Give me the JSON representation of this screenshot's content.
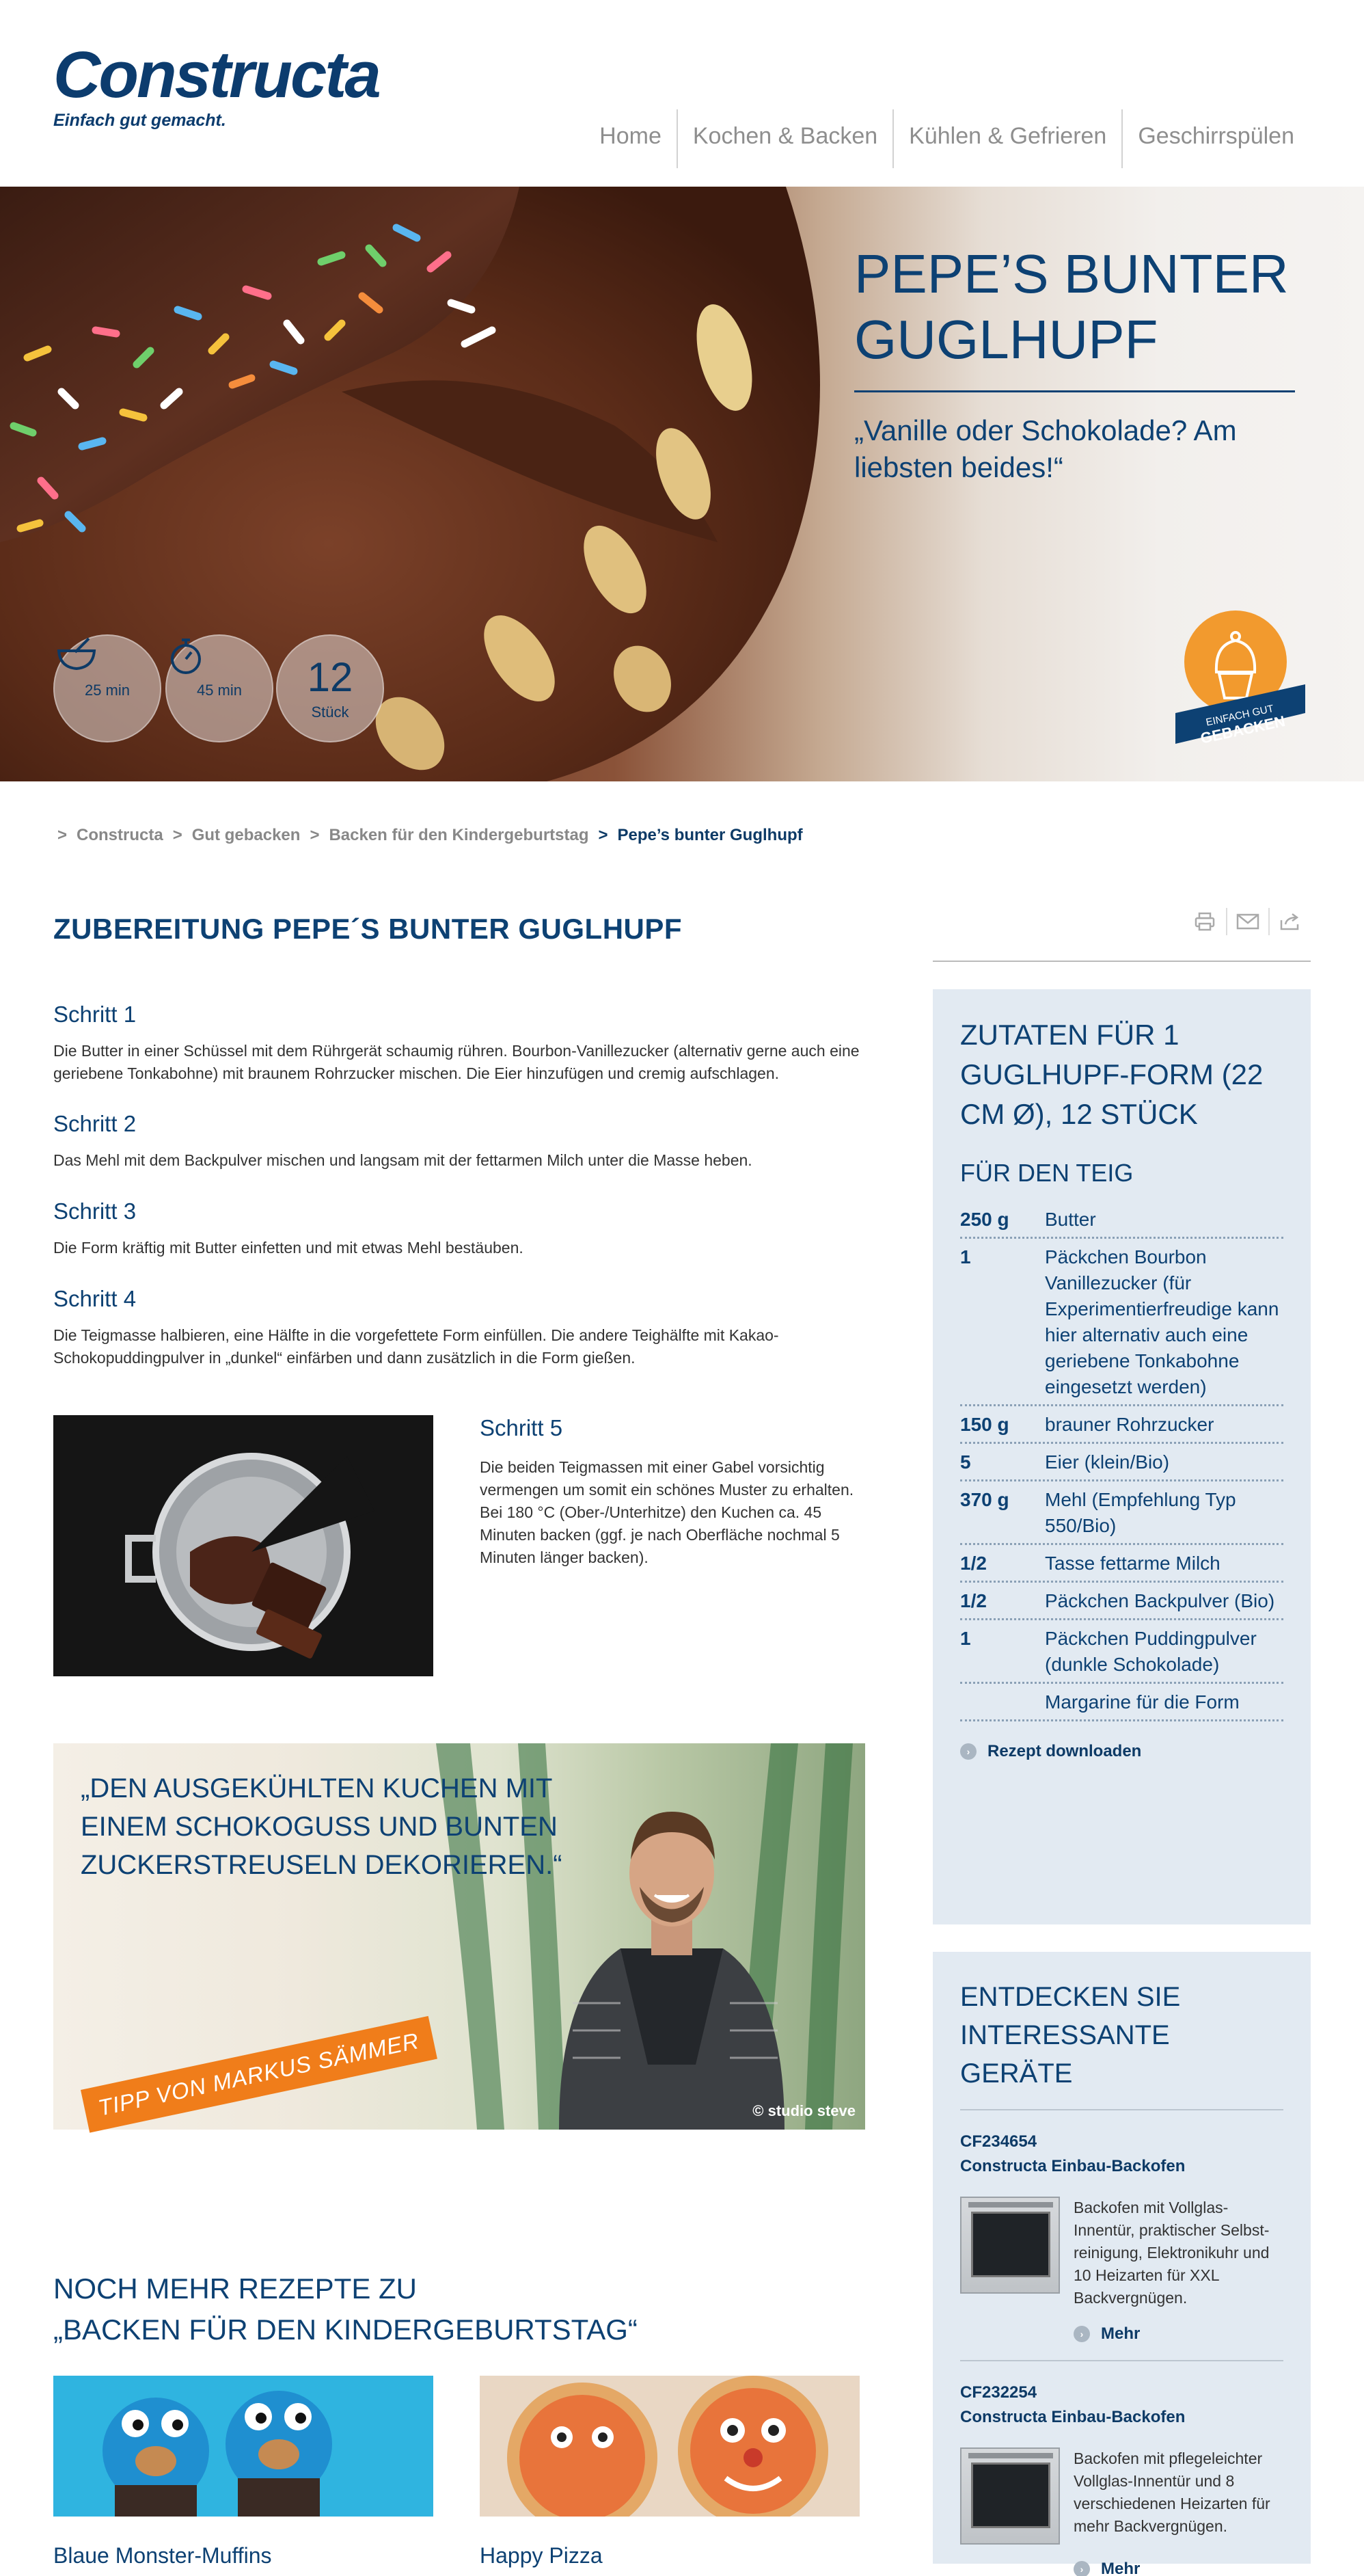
{
  "brand": {
    "name": "Constructa",
    "tagline": "Einfach gut gemacht."
  },
  "nav": {
    "items": [
      "Home",
      "Kochen & Backen",
      "Kühlen & Gefrieren",
      "Geschirrspülen"
    ]
  },
  "hero": {
    "title": "PEPE’S BUNTER GUGLHUPF",
    "quote": "„Vanille oder Schokolade? Am liebsten beides!“",
    "stats": [
      {
        "icon": "mixing-bowl-icon",
        "value": "",
        "label": "25 min"
      },
      {
        "icon": "stopwatch-icon",
        "value": "",
        "label": "45 min"
      },
      {
        "icon": "",
        "value": "12",
        "label": "Stück"
      }
    ],
    "badge": {
      "line1": "EINFACH GUT",
      "line2": "GEBACKEN"
    }
  },
  "breadcrumb": {
    "items": [
      "Constructa",
      "Gut gebacken",
      "Backen für den Kindergeburtstag",
      "Pepe’s bunter Guglhupf"
    ],
    "separator": ">"
  },
  "main": {
    "title": "ZUBEREITUNG PEPE´S BUNTER GUGLHUPF",
    "steps": [
      {
        "title": "Schritt 1",
        "text": "Die Butter in einer Schüssel mit dem Rührgerät schaumig rühren. Bourbon-Vanillezucker (alternativ gerne auch eine geriebene Tonkabohne) mit braunem Rohrzucker mischen. Die Eier hinzufügen und cremig aufschlagen."
      },
      {
        "title": "Schritt 2",
        "text": "Das Mehl mit dem Backpulver mischen und langsam mit der fettarmen Milch unter die Masse heben."
      },
      {
        "title": "Schritt 3",
        "text": "Die Form kräftig mit Butter einfetten und mit etwas Mehl bestäuben."
      },
      {
        "title": "Schritt 4",
        "text": "Die Teigmasse halbieren, eine Hälfte in die vorgefettete Form einfüllen. Die andere Teighälfte mit Kakao-Schokopuddingpulver in „dunkel“ einfärben und dann zusätzlich in die Form gießen."
      },
      {
        "title": "Schritt 5",
        "text": "Die beiden Teigmassen mit einer Gabel vorsichtig vermengen um somit ein schönes Muster zu erhalten.",
        "text2": "Bei 180 °C (Ober-/Unterhitze) den Kuchen ca. 45 Minuten backen (ggf. je nach Oberfläche nochmal 5 Minuten länger backen)."
      }
    ],
    "tip": {
      "quote": "„DEN AUSGEKÜHLTEN KUCHEN MIT EINEM SCHOKOGUSS UND BUNTEN ZUCKERSTREUSELN DEKORIEREN.“",
      "ribbon": "TIPP VON MARKUS SÄMMER",
      "credit": "© studio steve"
    },
    "more": {
      "title_line1": "NOCH MEHR REZEPTE ZU",
      "title_line2": "„BACKEN FÜR DEN KINDERGEBURTSTAG“",
      "recipes": [
        "Blaue Monster-Muffins",
        "Happy Pizza"
      ]
    }
  },
  "sidebar": {
    "share_icons": [
      "printer-icon",
      "mail-icon",
      "share-icon"
    ],
    "ingredients": {
      "title": "ZUTATEN FÜR 1 GUGLHUPF-FORM (22 CM Ø), 12 STÜCK",
      "subtitle": "FÜR DEN TEIG",
      "rows": [
        {
          "qty": "250 g",
          "name": "Butter"
        },
        {
          "qty": "1",
          "name": "Päckchen Bourbon Vanillezucker (für Experimentierfreudige kann hier alternativ auch eine geriebene Tonkabohne eingesetzt werden)"
        },
        {
          "qty": "150 g",
          "name": "brauner Rohrzucker"
        },
        {
          "qty": "5",
          "name": "Eier (klein/Bio)"
        },
        {
          "qty": "370 g",
          "name": "Mehl (Empfehlung Typ 550/Bio)"
        },
        {
          "qty": "1/2",
          "name": "Tasse fettarme Milch"
        },
        {
          "qty": "1/2",
          "name": "Päckchen Backpulver (Bio)"
        },
        {
          "qty": "1",
          "name": "Päckchen Puddingpulver (dunkle Schokolade)"
        },
        {
          "qty": "",
          "name": "Margarine für die Form"
        }
      ],
      "download": "Rezept downloaden"
    },
    "devices": {
      "title": "ENTDECKEN SIE INTERESSANTE GERÄTE",
      "items": [
        {
          "model": "CF234654",
          "name": "Constructa Einbau-Backofen",
          "desc": "Backofen mit Vollglas-Innentür, praktischer Selbst-reinigung, Elektronikuhr und 10 Heizarten für XXL Backvergnügen.",
          "more": "Mehr"
        },
        {
          "model": "CF232254",
          "name": "Constructa Einbau-Backofen",
          "desc": "Backofen mit pflegeleichter Vollglas-Innentür und 8 verschiedenen Heizarten für mehr Backvergnügen.",
          "more": "Mehr"
        }
      ]
    }
  },
  "colors": {
    "brand_blue": "#0d4173",
    "sidebar_bg": "#e2eaf2",
    "tip_orange": "#f07d1a"
  }
}
